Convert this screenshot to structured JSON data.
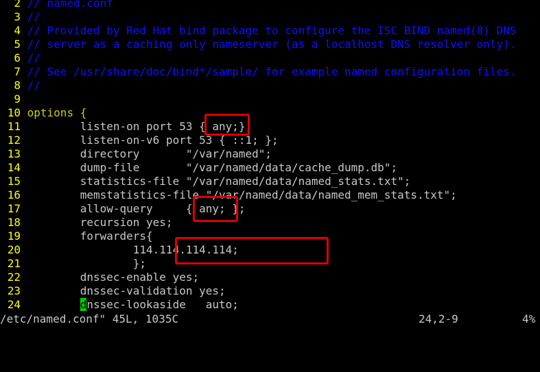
{
  "lines": [
    {
      "n": "2",
      "style": "comment",
      "text": "// named.conf"
    },
    {
      "n": "3",
      "style": "comment",
      "text": "//"
    },
    {
      "n": "4",
      "style": "comment",
      "text": "// Provided by Red Hat bind package to configure the ISC BIND named(8) DNS"
    },
    {
      "n": "5",
      "style": "comment",
      "text": "// server as a caching only nameserver (as a localhost DNS resolver only)."
    },
    {
      "n": "6",
      "style": "comment",
      "text": "//"
    },
    {
      "n": "7",
      "style": "comment",
      "text": "// See /usr/share/doc/bind*/sample/ for example named configuration files."
    },
    {
      "n": "8",
      "style": "comment",
      "text": "//"
    },
    {
      "n": "9",
      "style": "code",
      "text": ""
    },
    {
      "n": "10",
      "style": "keyword",
      "text": "options {"
    },
    {
      "n": "11",
      "style": "code",
      "text": "        listen-on port 53 { any;};"
    },
    {
      "n": "12",
      "style": "code",
      "text": "        listen-on-v6 port 53 { ::1; };"
    },
    {
      "n": "13",
      "style": "code",
      "text": "        directory       \"/var/named\";"
    },
    {
      "n": "14",
      "style": "code",
      "text": "        dump-file       \"/var/named/data/cache_dump.db\";"
    },
    {
      "n": "15",
      "style": "code",
      "text": "        statistics-file \"/var/named/data/named_stats.txt\";"
    },
    {
      "n": "16",
      "style": "code",
      "text": "        memstatistics-file \"/var/named/data/named_mem_stats.txt\";"
    },
    {
      "n": "17",
      "style": "code",
      "text": "        allow-query     { any; };"
    },
    {
      "n": "18",
      "style": "code",
      "text": "        recursion yes;"
    },
    {
      "n": "19",
      "style": "code",
      "text": "        forwarders{"
    },
    {
      "n": "20",
      "style": "code",
      "text": "                114.114.114.114;"
    },
    {
      "n": "21",
      "style": "code",
      "text": "                };"
    },
    {
      "n": "22",
      "style": "code",
      "text": "        dnssec-enable yes;"
    },
    {
      "n": "23",
      "style": "code",
      "text": "        dnssec-validation yes;"
    },
    {
      "n": "24",
      "style": "cursor",
      "text": "        dnssec-lookaside   auto;"
    }
  ],
  "cursor_line": {
    "indent": "        ",
    "char": "d",
    "rest": "nssec-lookaside   auto;"
  },
  "status": {
    "file": "/etc/named.conf\" 45L, 1035C",
    "position": "24,2-9",
    "percent": "4%"
  },
  "colors": {
    "comment": "#1010ff",
    "linenumber": "#ffff00",
    "highlight": "#e00000",
    "cursor": "#00d000"
  }
}
